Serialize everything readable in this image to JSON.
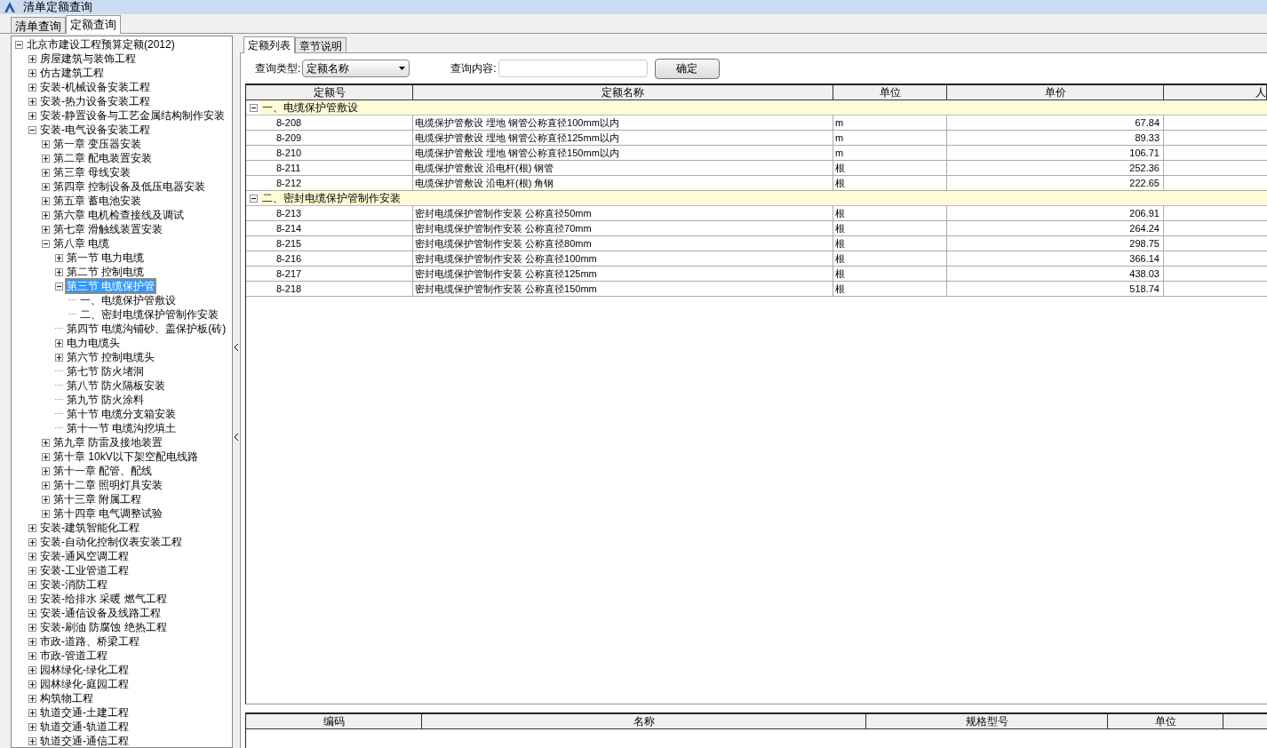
{
  "window": {
    "title": "清单定额查询"
  },
  "tabs": [
    {
      "label": "清单查询",
      "selected": false
    },
    {
      "label": "定额查询",
      "selected": true
    }
  ],
  "tree": [
    {
      "label": "北京市建设工程预算定额(2012)",
      "kind": "branch",
      "expanded": true,
      "selected": false,
      "children": [
        {
          "label": "房屋建筑与装饰工程",
          "kind": "branch",
          "expanded": false,
          "selected": false
        },
        {
          "label": "仿古建筑工程",
          "kind": "branch",
          "expanded": false,
          "selected": false
        },
        {
          "label": "安装-机械设备安装工程",
          "kind": "branch",
          "expanded": false,
          "selected": false
        },
        {
          "label": "安装-热力设备安装工程",
          "kind": "branch",
          "expanded": false,
          "selected": false
        },
        {
          "label": "安装-静置设备与工艺金属结构制作安装",
          "kind": "branch",
          "expanded": false,
          "selected": false
        },
        {
          "label": "安装-电气设备安装工程",
          "kind": "branch",
          "expanded": true,
          "selected": false,
          "children": [
            {
              "label": "第一章 变压器安装",
              "kind": "branch",
              "expanded": false,
              "selected": false
            },
            {
              "label": "第二章 配电装置安装",
              "kind": "branch",
              "expanded": false,
              "selected": false
            },
            {
              "label": "第三章 母线安装",
              "kind": "branch",
              "expanded": false,
              "selected": false
            },
            {
              "label": "第四章 控制设备及低压电器安装",
              "kind": "branch",
              "expanded": false,
              "selected": false
            },
            {
              "label": "第五章 蓄电池安装",
              "kind": "branch",
              "expanded": false,
              "selected": false
            },
            {
              "label": "第六章 电机检查接线及调试",
              "kind": "branch",
              "expanded": false,
              "selected": false
            },
            {
              "label": "第七章 滑触线装置安装",
              "kind": "branch",
              "expanded": false,
              "selected": false
            },
            {
              "label": "第八章 电缆",
              "kind": "branch",
              "expanded": true,
              "selected": false,
              "children": [
                {
                  "label": "第一节 电力电缆",
                  "kind": "branch",
                  "expanded": false,
                  "selected": false
                },
                {
                  "label": "第二节 控制电缆",
                  "kind": "branch",
                  "expanded": false,
                  "selected": false
                },
                {
                  "label": "第三节 电缆保护管",
                  "kind": "branch",
                  "expanded": true,
                  "selected": true,
                  "children": [
                    {
                      "label": "一、电缆保护管敷设",
                      "kind": "leaf",
                      "selected": false
                    },
                    {
                      "label": "二、密封电缆保护管制作安装",
                      "kind": "leaf",
                      "selected": false
                    }
                  ]
                },
                {
                  "label": "第四节 电缆沟铺砂、盖保护板(砖)",
                  "kind": "leaf",
                  "selected": false
                },
                {
                  "label": "电力电缆头",
                  "kind": "branch",
                  "expanded": false,
                  "selected": false
                },
                {
                  "label": "第六节 控制电缆头",
                  "kind": "branch",
                  "expanded": false,
                  "selected": false
                },
                {
                  "label": "第七节 防火堵洞",
                  "kind": "leaf",
                  "selected": false
                },
                {
                  "label": "第八节 防火隔板安装",
                  "kind": "leaf",
                  "selected": false
                },
                {
                  "label": "第九节 防火涂料",
                  "kind": "leaf",
                  "selected": false
                },
                {
                  "label": "第十节 电缆分支箱安装",
                  "kind": "leaf",
                  "selected": false
                },
                {
                  "label": "第十一节 电缆沟挖填土",
                  "kind": "leaf",
                  "selected": false
                }
              ]
            },
            {
              "label": "第九章 防雷及接地装置",
              "kind": "branch",
              "expanded": false,
              "selected": false
            },
            {
              "label": "第十章 10kV以下架空配电线路",
              "kind": "branch",
              "expanded": false,
              "selected": false
            },
            {
              "label": "第十一章 配管、配线",
              "kind": "branch",
              "expanded": false,
              "selected": false
            },
            {
              "label": "第十二章 照明灯具安装",
              "kind": "branch",
              "expanded": false,
              "selected": false
            },
            {
              "label": "第十三章 附属工程",
              "kind": "branch",
              "expanded": false,
              "selected": false
            },
            {
              "label": "第十四章 电气调整试验",
              "kind": "branch",
              "expanded": false,
              "selected": false
            }
          ]
        },
        {
          "label": "安装-建筑智能化工程",
          "kind": "branch",
          "expanded": false,
          "selected": false
        },
        {
          "label": "安装-自动化控制仪表安装工程",
          "kind": "branch",
          "expanded": false,
          "selected": false
        },
        {
          "label": "安装-通风空调工程",
          "kind": "branch",
          "expanded": false,
          "selected": false
        },
        {
          "label": "安装-工业管道工程",
          "kind": "branch",
          "expanded": false,
          "selected": false
        },
        {
          "label": "安装-消防工程",
          "kind": "branch",
          "expanded": false,
          "selected": false
        },
        {
          "label": "安装-给排水 采暖 燃气工程",
          "kind": "branch",
          "expanded": false,
          "selected": false
        },
        {
          "label": "安装-通信设备及线路工程",
          "kind": "branch",
          "expanded": false,
          "selected": false
        },
        {
          "label": "安装-刷油 防腐蚀 绝热工程",
          "kind": "branch",
          "expanded": false,
          "selected": false
        },
        {
          "label": "市政-道路、桥梁工程",
          "kind": "branch",
          "expanded": false,
          "selected": false
        },
        {
          "label": "市政-管道工程",
          "kind": "branch",
          "expanded": false,
          "selected": false
        },
        {
          "label": "园林绿化-绿化工程",
          "kind": "branch",
          "expanded": false,
          "selected": false
        },
        {
          "label": "园林绿化-庭园工程",
          "kind": "branch",
          "expanded": false,
          "selected": false
        },
        {
          "label": "构筑物工程",
          "kind": "branch",
          "expanded": false,
          "selected": false
        },
        {
          "label": "轨道交通-土建工程",
          "kind": "branch",
          "expanded": false,
          "selected": false
        },
        {
          "label": "轨道交通-轨道工程",
          "kind": "branch",
          "expanded": false,
          "selected": false
        },
        {
          "label": "轨道交通-通信工程",
          "kind": "branch",
          "expanded": false,
          "selected": false
        }
      ]
    }
  ],
  "subtabs": [
    {
      "label": "定额列表",
      "selected": true
    },
    {
      "label": "章节说明",
      "selected": false
    }
  ],
  "query": {
    "type_label": "查询类型:",
    "type_value": "定额名称",
    "content_label": "查询内容:",
    "confirm": "确定"
  },
  "table": {
    "columns": [
      "定额号",
      "定额名称",
      "单位",
      "单价",
      "人"
    ],
    "groups": [
      {
        "title": "一、电缆保护管敷设",
        "expanded": true,
        "rows": [
          {
            "code": "8-208",
            "name": "电缆保护管敷设 埋地 钢管公称直径100mm以内",
            "unit": "m",
            "price": "67.84"
          },
          {
            "code": "8-209",
            "name": "电缆保护管敷设 埋地 钢管公称直径125mm以内",
            "unit": "m",
            "price": "89.33"
          },
          {
            "code": "8-210",
            "name": "电缆保护管敷设 埋地 钢管公称直径150mm以内",
            "unit": "m",
            "price": "106.71"
          },
          {
            "code": "8-211",
            "name": "电缆保护管敷设 沿电杆(根) 钢管",
            "unit": "根",
            "price": "252.36"
          },
          {
            "code": "8-212",
            "name": "电缆保护管敷设 沿电杆(根) 角钢",
            "unit": "根",
            "price": "222.65"
          }
        ]
      },
      {
        "title": "二、密封电缆保护管制作安装",
        "expanded": true,
        "rows": [
          {
            "code": "8-213",
            "name": "密封电缆保护管制作安装 公称直径50mm",
            "unit": "根",
            "price": "206.91"
          },
          {
            "code": "8-214",
            "name": "密封电缆保护管制作安装 公称直径70mm",
            "unit": "根",
            "price": "264.24"
          },
          {
            "code": "8-215",
            "name": "密封电缆保护管制作安装 公称直径80mm",
            "unit": "根",
            "price": "298.75"
          },
          {
            "code": "8-216",
            "name": "密封电缆保护管制作安装 公称直径100mm",
            "unit": "根",
            "price": "366.14"
          },
          {
            "code": "8-217",
            "name": "密封电缆保护管制作安装 公称直径125mm",
            "unit": "根",
            "price": "438.03"
          },
          {
            "code": "8-218",
            "name": "密封电缆保护管制作安装 公称直径150mm",
            "unit": "根",
            "price": "518.74"
          }
        ]
      }
    ]
  },
  "materials": {
    "columns": [
      "编码",
      "名称",
      "规格型号",
      "单位"
    ]
  }
}
